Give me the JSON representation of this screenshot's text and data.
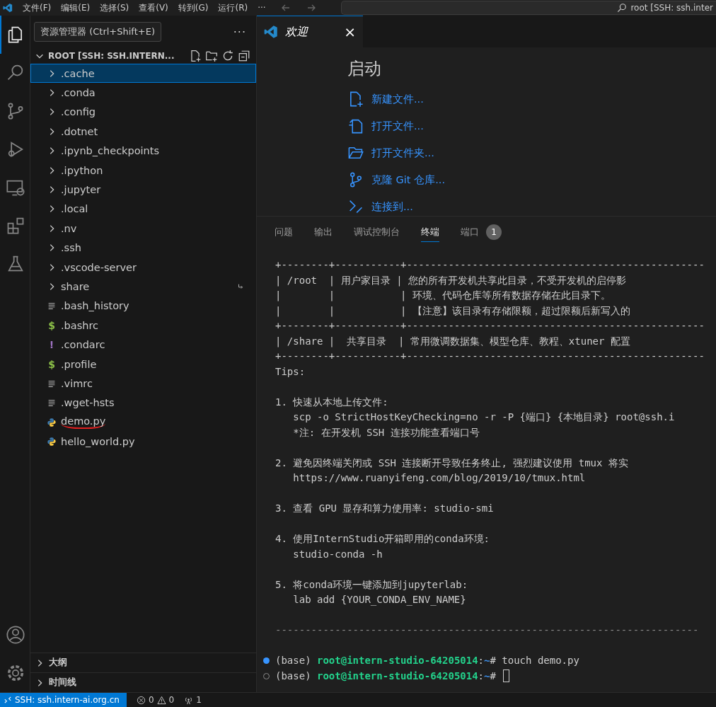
{
  "menu_bar": {
    "items": [
      "文件(F)",
      "编辑(E)",
      "选择(S)",
      "查看(V)",
      "转到(G)",
      "运行(R)"
    ],
    "more": "···",
    "search": "root [SSH: ssh.inter"
  },
  "activity_bar": {
    "items": [
      {
        "selected": true
      },
      {
        "selected": false
      },
      {
        "selected": false
      },
      {
        "selected": false
      },
      {
        "selected": false
      },
      {
        "selected": false
      },
      {
        "selected": false
      }
    ]
  },
  "sidebar": {
    "tooltip": "资源管理器 (Ctrl+Shift+E)",
    "more": "···",
    "root": {
      "label": "ROOT [SSH: SSH.INTERN...",
      "expanded": true
    },
    "items": [
      {
        "label": ".cache",
        "kind": "folder",
        "selected": true
      },
      {
        "label": ".conda",
        "kind": "folder",
        "selected": false
      },
      {
        "label": ".config",
        "kind": "folder",
        "selected": false
      },
      {
        "label": ".dotnet",
        "kind": "folder",
        "selected": false
      },
      {
        "label": ".ipynb_checkpoints",
        "kind": "folder",
        "selected": false
      },
      {
        "label": ".ipython",
        "kind": "folder",
        "selected": false
      },
      {
        "label": ".jupyter",
        "kind": "folder",
        "selected": false
      },
      {
        "label": ".local",
        "kind": "folder",
        "selected": false
      },
      {
        "label": ".nv",
        "kind": "folder",
        "selected": false
      },
      {
        "label": ".ssh",
        "kind": "folder",
        "selected": false
      },
      {
        "label": ".vscode-server",
        "kind": "folder",
        "selected": false
      },
      {
        "label": "share",
        "kind": "link-folder",
        "selected": false
      },
      {
        "label": ".bash_history",
        "kind": "text",
        "selected": false
      },
      {
        "label": ".bashrc",
        "kind": "glyph",
        "glyph": "$",
        "color": "#8dc149",
        "selected": false
      },
      {
        "label": ".condarc",
        "kind": "glyph",
        "glyph": "!",
        "color": "#a074c4",
        "selected": false
      },
      {
        "label": ".profile",
        "kind": "glyph",
        "glyph": "$",
        "color": "#8dc149",
        "selected": false
      },
      {
        "label": ".vimrc",
        "kind": "text",
        "selected": false
      },
      {
        "label": ".wget-hsts",
        "kind": "text",
        "selected": false
      },
      {
        "label": "demo.py",
        "kind": "python",
        "selected": false,
        "underlined": true
      },
      {
        "label": "hello_world.py",
        "kind": "python",
        "selected": false,
        "underlined": false
      }
    ],
    "sections": [
      {
        "label": "大纲",
        "expanded": false
      },
      {
        "label": "时间线",
        "expanded": false
      }
    ]
  },
  "editor": {
    "tab": {
      "label": "欢迎",
      "close": "×"
    },
    "welcome": {
      "heading": "启动",
      "links": [
        {
          "label": "新建文件..."
        },
        {
          "label": "打开文件..."
        },
        {
          "label": "打开文件夹..."
        },
        {
          "label": "克隆 Git 仓库..."
        },
        {
          "label": "连接到..."
        }
      ]
    }
  },
  "panel": {
    "tabs": [
      {
        "label": "问题",
        "selected": false
      },
      {
        "label": "输出",
        "selected": false
      },
      {
        "label": "调试控制台",
        "selected": false
      },
      {
        "label": "终端",
        "selected": true
      },
      {
        "label": "端口",
        "selected": false,
        "badge": "1"
      }
    ],
    "terminal": {
      "blocks": [
        {
          "kind": "text",
          "lines": [
            "+--------+-----------+--------------------------------------------------",
            "| /root  | 用户家目录 | 您的所有开发机共享此目录，不受开发机的启停影",
            "|        |           | 环境、代码仓库等所有数据存储在此目录下。",
            "|        |           | 【注意】该目录有存储限额，超过限额后新写入的",
            "+--------+-----------+--------------------------------------------------",
            "| /share |  共享目录  | 常用微调数据集、模型仓库、教程、xtuner 配置",
            "+--------+-----------+--------------------------------------------------",
            "Tips:"
          ]
        },
        {
          "kind": "text",
          "lines": [
            "1. 快速从本地上传文件:",
            "   scp -o StrictHostKeyChecking=no -r -P {端口} {本地目录} root@ssh.i",
            "   *注: 在开发机 SSH 连接功能查看端口号"
          ]
        },
        {
          "kind": "text",
          "lines": [
            "2. 避免因终端关闭或 SSH 连接断开导致任务终止, 强烈建议使用 tmux 将实",
            "   https://www.ruanyifeng.com/blog/2019/10/tmux.html"
          ]
        },
        {
          "kind": "text",
          "lines": [
            "3. 查看 GPU 显存和算力使用率: studio-smi"
          ]
        },
        {
          "kind": "text",
          "lines": [
            "4. 使用InternStudio开箱即用的conda环境:",
            "   studio-conda -h"
          ]
        },
        {
          "kind": "text",
          "lines": [
            "5. 将conda环境一键添加到jupyterlab:",
            "   lab add {YOUR_CONDA_ENV_NAME}"
          ]
        },
        {
          "kind": "rule",
          "lines": [
            "-----------------------------------------------------------------------"
          ]
        },
        {
          "kind": "prompts",
          "prompts": [
            {
              "succeeded": true,
              "env": "(base)",
              "user": "root@intern-studio-64205014",
              "sep": ":",
              "path": "~",
              "symbol": "#",
              "command": "touch demo.py",
              "cursor": false
            },
            {
              "succeeded": false,
              "env": "(base)",
              "user": "root@intern-studio-64205014",
              "sep": ":",
              "path": "~",
              "symbol": "#",
              "cursor": true
            }
          ]
        }
      ]
    }
  },
  "status_bar": {
    "remote": "SSH: ssh.intern-ai.org.cn",
    "errors": "0",
    "warnings": "0",
    "ports": "1"
  }
}
